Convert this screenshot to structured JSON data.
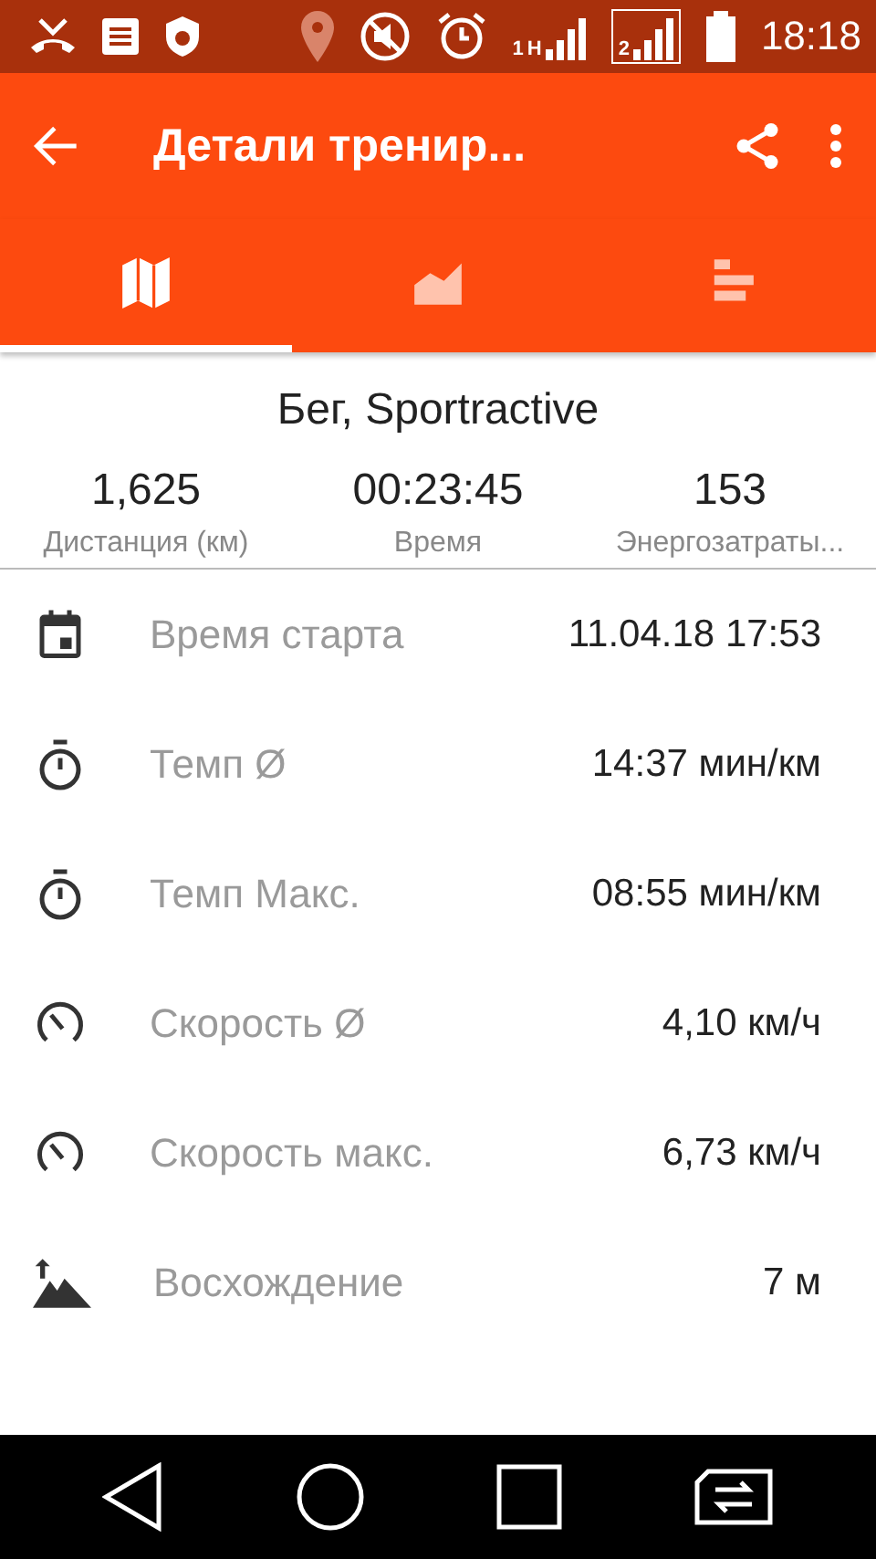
{
  "status_bar": {
    "network_type": "H",
    "sim_1": "1",
    "sim_2": "2",
    "time": "18:18"
  },
  "toolbar": {
    "title": "Детали тренир..."
  },
  "tabs": [
    {
      "kind": "map",
      "selected": true
    },
    {
      "kind": "chart",
      "selected": false
    },
    {
      "kind": "bars",
      "selected": false
    }
  ],
  "summary": {
    "title": "Бег, Sportractive",
    "stats": [
      {
        "value": "1,625",
        "label": "Дистанция (км)"
      },
      {
        "value": "00:23:45",
        "label": "Время"
      },
      {
        "value": "153",
        "label": "Энергозатраты..."
      }
    ]
  },
  "details": [
    {
      "kind": "calendar",
      "label": "Время старта",
      "value": "11.04.18 17:53"
    },
    {
      "kind": "stopwatch",
      "label": "Темп Ø",
      "value": "14:37 мин/км"
    },
    {
      "kind": "stopwatch",
      "label": "Темп Макс.",
      "value": "08:55 мин/км"
    },
    {
      "kind": "speedometer",
      "label": "Скорость Ø",
      "value": "4,10 км/ч"
    },
    {
      "kind": "speedometer",
      "label": "Скорость макс.",
      "value": "6,73 км/ч"
    },
    {
      "kind": "mountain",
      "label": "Восхождение",
      "value": "7 м"
    }
  ]
}
